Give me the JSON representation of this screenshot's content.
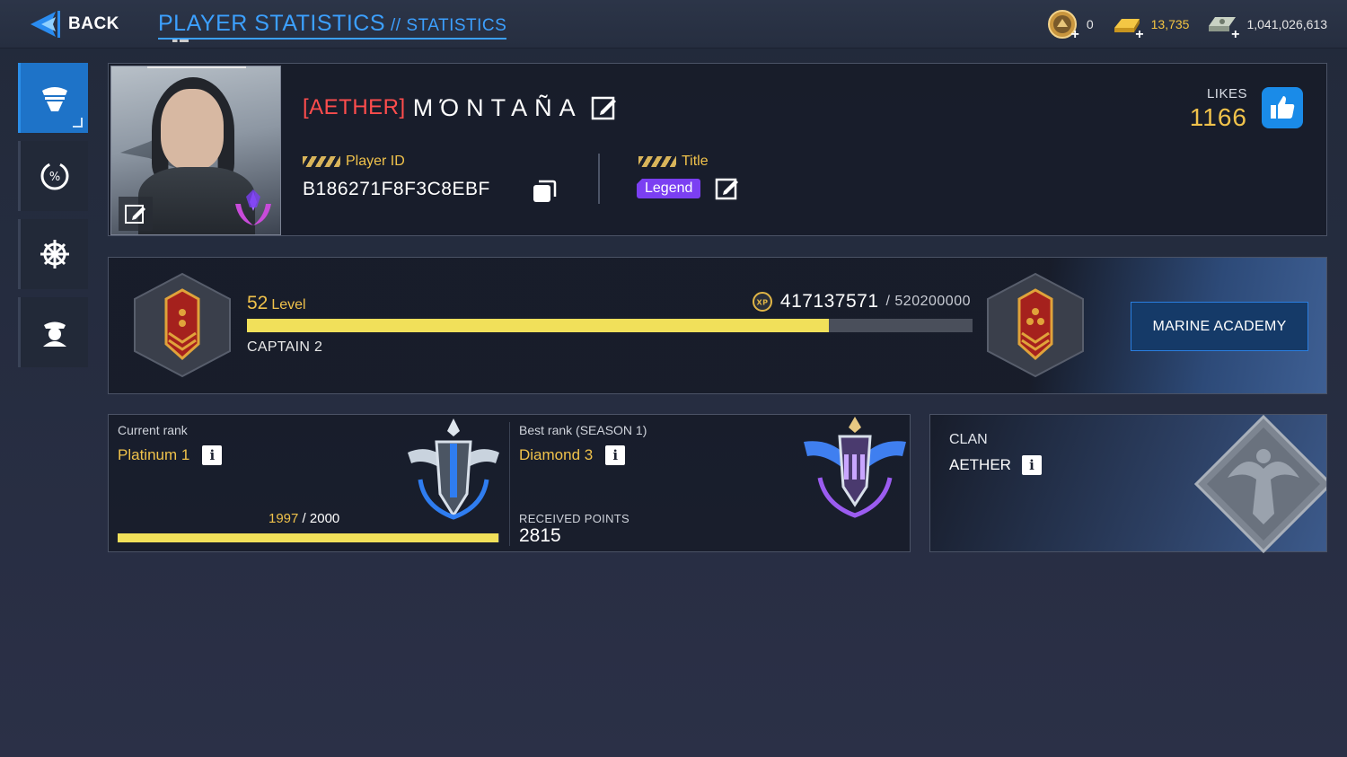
{
  "header": {
    "back_label": "BACK",
    "title": "PLAYER STATISTICS",
    "subtitle": "// STATISTICS"
  },
  "currencies": [
    {
      "icon": "medal-coin-icon",
      "value": "0"
    },
    {
      "icon": "gold-bar-icon",
      "value": "13,735"
    },
    {
      "icon": "banknotes-icon",
      "value": "1,041,026,613"
    }
  ],
  "sidebar": {
    "items": [
      {
        "icon": "officer-cap-icon",
        "active": true
      },
      {
        "icon": "percent-gauge-icon",
        "active": false
      },
      {
        "icon": "ship-wheel-icon",
        "active": false
      },
      {
        "icon": "captain-portrait-icon",
        "active": false
      }
    ]
  },
  "profile": {
    "clan_tag": "[AETHER]",
    "name": "MΌNTAÑA",
    "player_id_label": "Player ID",
    "player_id": "B186271F8F3C8EBF",
    "title_label": "Title",
    "title_value": "Legend",
    "likes_label": "LIKES",
    "likes_value": "1166"
  },
  "level": {
    "level_number": "52",
    "level_word": "Level",
    "xp_current": "417137571",
    "xp_max": "/ 520200000",
    "xp_fraction": 0.802,
    "rank_name": "CAPTAIN 2",
    "academy_button": "MARINE ACADEMY"
  },
  "rank": {
    "current_label": "Current rank",
    "current_value": "Platinum 1",
    "progress_value": "1997",
    "progress_max": "/ 2000",
    "progress_fraction": 0.9985,
    "best_label": "Best rank (SEASON 1)",
    "best_value": "Diamond 3",
    "received_label": "RECEIVED POINTS",
    "received_value": "2815"
  },
  "clan": {
    "label": "CLAN",
    "value": "AETHER"
  },
  "colors": {
    "accent_blue": "#3ca0ff",
    "gold_text": "#f0c24b",
    "clan_red": "#ff4d4d",
    "progress_yellow": "#f1e05a",
    "title_purple": "#7b3ff2"
  }
}
